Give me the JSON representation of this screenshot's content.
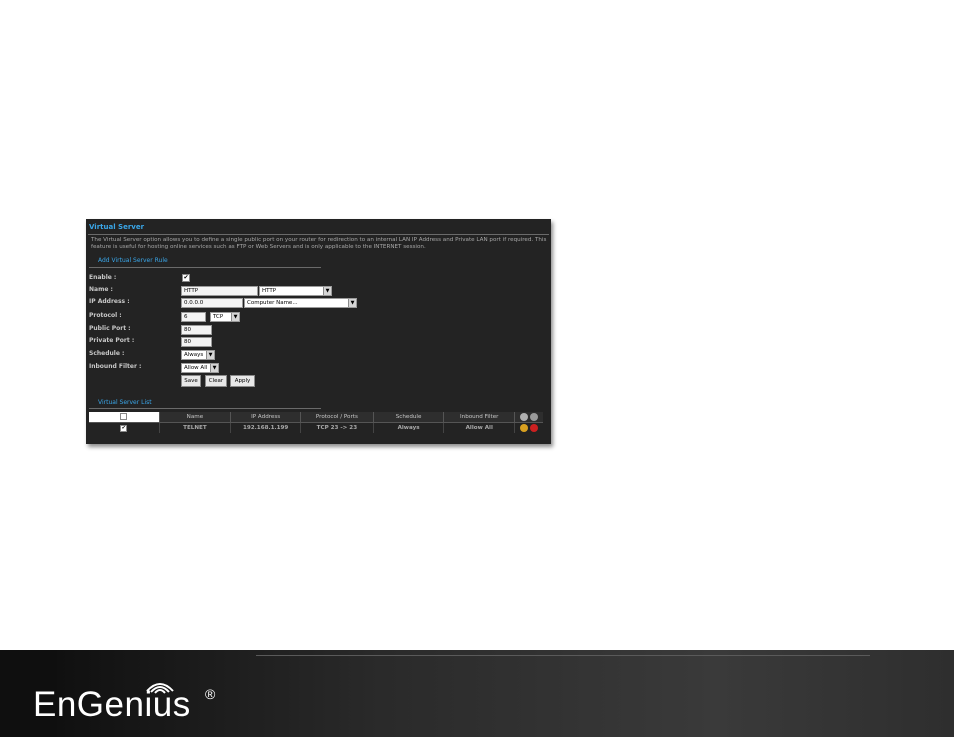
{
  "panel": {
    "title": "Virtual Server",
    "description": "The Virtual Server option allows you to define a single public port on your router for redirection to an internal LAN IP Address and Private LAN port if required. This feature is useful for hosting online services such as FTP or Web Servers and is only applicable to the INTERNET session.",
    "add_rule_heading": "Add Virtual Server Rule",
    "form": {
      "enable_label": "Enable :",
      "enable_checked": true,
      "name_label": "Name :",
      "name_value": "HTTP",
      "name_select": "HTTP",
      "ip_label": "IP Address :",
      "ip_value": "0.0.0.0",
      "computer_select": "Computer Name...",
      "protocol_label": "Protocol :",
      "protocol_number": "6",
      "protocol_select": "TCP",
      "public_port_label": "Public Port :",
      "public_port_value": "80",
      "private_port_label": "Private Port :",
      "private_port_value": "80",
      "schedule_label": "Schedule :",
      "schedule_select": "Always",
      "inbound_label": "Inbound Filter :",
      "inbound_select": "Allow All",
      "save_label": "Save",
      "clear_label": "Clear",
      "apply_label": "Apply"
    },
    "list_heading": "Virtual Server List",
    "table": {
      "headers": [
        "Name",
        "IP Address",
        "Protocol / Ports",
        "Schedule",
        "Inbound Filter"
      ],
      "rows": [
        {
          "checked": true,
          "name": "TELNET",
          "ip": "192.168.1.199",
          "protocol_ports": "TCP 23 -> 23",
          "schedule": "Always",
          "inbound": "Allow All"
        }
      ]
    }
  },
  "footer": {
    "logo_text": "EnGenius",
    "registered_mark": "®"
  },
  "colors": {
    "panel_bg": "#232323",
    "heading_blue": "#3aa6e8",
    "footer_bg": "#2a2a2a"
  },
  "icons": [
    "checkbox-icon",
    "dropdown-arrow-icon",
    "edit-pencil-icon",
    "delete-icon",
    "wifi-waves-icon"
  ]
}
